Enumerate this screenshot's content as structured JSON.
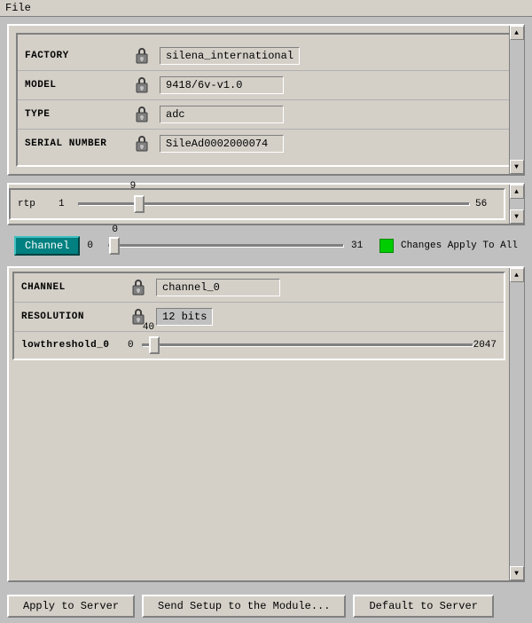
{
  "menu": {
    "file_label": "File"
  },
  "factory_panel": {
    "fields": [
      {
        "label": "FACTORY",
        "value": "silena_international"
      },
      {
        "label": "MODEL",
        "value": "9418/6v-v1.0"
      },
      {
        "label": "TYPE",
        "value": "adc"
      },
      {
        "label": "SERIAL NUMBER",
        "value": "SileAd0002000074"
      }
    ]
  },
  "rtp_panel": {
    "label": "rtp",
    "min": "1",
    "max": "56",
    "value": "9",
    "thumb_pct": 14
  },
  "channel_bar": {
    "btn_label": "Channel",
    "min": "0",
    "max": "31",
    "value": "0",
    "thumb_pct": 0,
    "changes_label": "Changes Apply To All",
    "value_label": "0"
  },
  "bottom_panel": {
    "fields": [
      {
        "label": "CHANNEL",
        "value": "channel_0"
      },
      {
        "label": "RESOLUTION",
        "value": "12 bits"
      }
    ],
    "slider": {
      "label": "lowthreshold_0",
      "min": "0",
      "max": "2047",
      "value": "40",
      "thumb_pct": 2
    }
  },
  "footer": {
    "apply_label": "Apply to Server",
    "send_label": "Send Setup to the Module...",
    "default_label": "Default to Server"
  }
}
